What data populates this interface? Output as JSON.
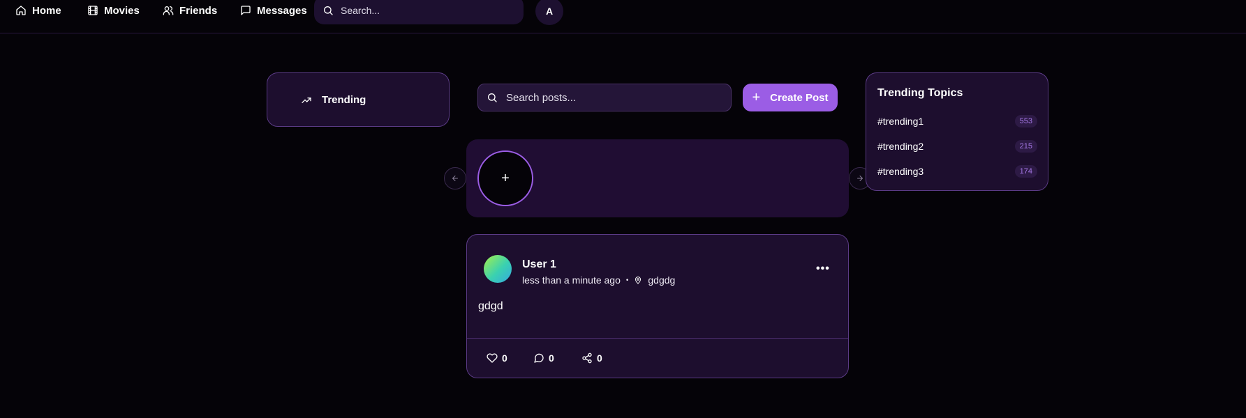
{
  "nav": {
    "items": [
      {
        "label": "Home",
        "icon": "home-icon"
      },
      {
        "label": "Movies",
        "icon": "film-icon"
      },
      {
        "label": "Friends",
        "icon": "users-icon"
      },
      {
        "label": "Messages",
        "icon": "message-icon"
      }
    ],
    "search_placeholder": "Search...",
    "avatar_initial": "A"
  },
  "sidebar": {
    "trending_label": "Trending"
  },
  "feed": {
    "search_placeholder": "Search posts...",
    "create_post_label": "Create Post",
    "add_story_symbol": "+",
    "posts": [
      {
        "user": "User 1",
        "time": "less than a minute ago",
        "separator": "•",
        "location": "gdgdg",
        "body": "gdgd",
        "likes": "0",
        "comments": "0",
        "shares": "0",
        "more": "•••"
      }
    ]
  },
  "trending": {
    "title": "Trending Topics",
    "topics": [
      {
        "tag": "#trending1",
        "count": "553"
      },
      {
        "tag": "#trending2",
        "count": "215"
      },
      {
        "tag": "#trending3",
        "count": "174"
      }
    ]
  },
  "colors": {
    "background": "#050308",
    "card": "#1d0e2e",
    "accent": "#9b5de5",
    "border": "#5b3b86"
  }
}
